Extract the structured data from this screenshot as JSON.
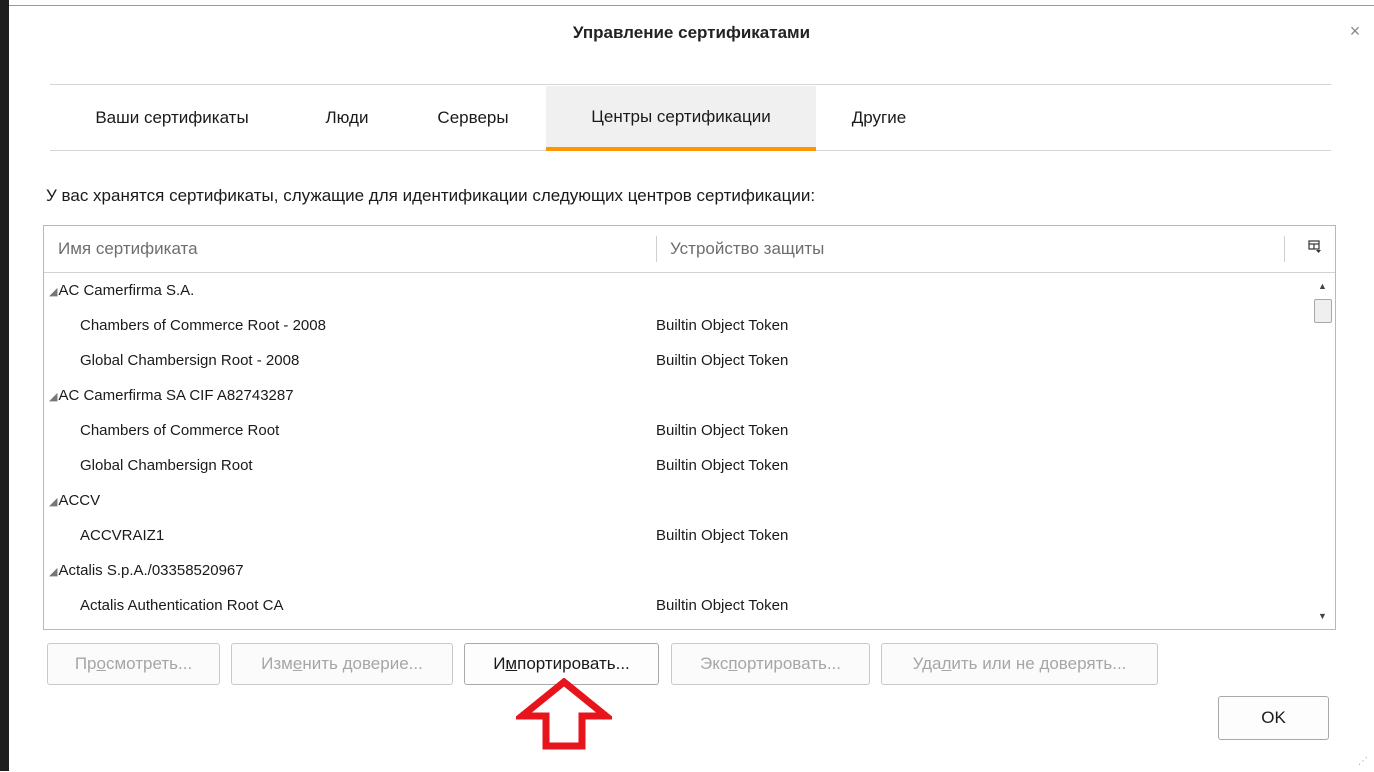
{
  "window": {
    "title": "Управление сертификатами",
    "close_glyph": "×"
  },
  "tabs": [
    {
      "label": "Ваши сертификаты",
      "active": false
    },
    {
      "label": "Люди",
      "active": false
    },
    {
      "label": "Серверы",
      "active": false
    },
    {
      "label": "Центры сертификации",
      "active": true
    },
    {
      "label": "Другие",
      "active": false
    }
  ],
  "description": "У вас хранятся сертификаты, служащие для идентификации следующих центров сертификации:",
  "tree": {
    "columns": {
      "name": "Имя сертификата",
      "device": "Устройство защиты"
    },
    "column_picker_icon": "column-picker-icon",
    "rows": [
      {
        "type": "group",
        "name": "AC Camerfirma S.A.",
        "token": ""
      },
      {
        "type": "child",
        "name": "Chambers of Commerce Root - 2008",
        "token": "Builtin Object Token"
      },
      {
        "type": "child",
        "name": "Global Chambersign Root - 2008",
        "token": "Builtin Object Token"
      },
      {
        "type": "group",
        "name": "AC Camerfirma SA CIF A82743287",
        "token": ""
      },
      {
        "type": "child",
        "name": "Chambers of Commerce Root",
        "token": "Builtin Object Token"
      },
      {
        "type": "child",
        "name": "Global Chambersign Root",
        "token": "Builtin Object Token"
      },
      {
        "type": "group",
        "name": "ACCV",
        "token": ""
      },
      {
        "type": "child",
        "name": "ACCVRAIZ1",
        "token": "Builtin Object Token"
      },
      {
        "type": "group",
        "name": "Actalis S.p.A./03358520967",
        "token": ""
      },
      {
        "type": "child",
        "name": "Actalis Authentication Root CA",
        "token": "Builtin Object Token"
      }
    ]
  },
  "buttons": {
    "view": {
      "pre": "Пр",
      "key": "о",
      "post": "смотреть...",
      "enabled": false
    },
    "edit_trust": {
      "pre": "Изм",
      "key": "е",
      "post": "нить доверие...",
      "enabled": false
    },
    "import": {
      "pre": "И",
      "key": "м",
      "post": "портировать...",
      "enabled": true
    },
    "export": {
      "pre": "Экс",
      "key": "п",
      "post": "ортировать...",
      "enabled": false
    },
    "delete": {
      "pre": "Уда",
      "key": "л",
      "post": "ить или не доверять...",
      "enabled": false
    },
    "ok": "OK"
  },
  "colors": {
    "active_tab_underline": "#ff9500",
    "arrow": "#e8141c",
    "disabled_text": "#a6a6a6"
  }
}
